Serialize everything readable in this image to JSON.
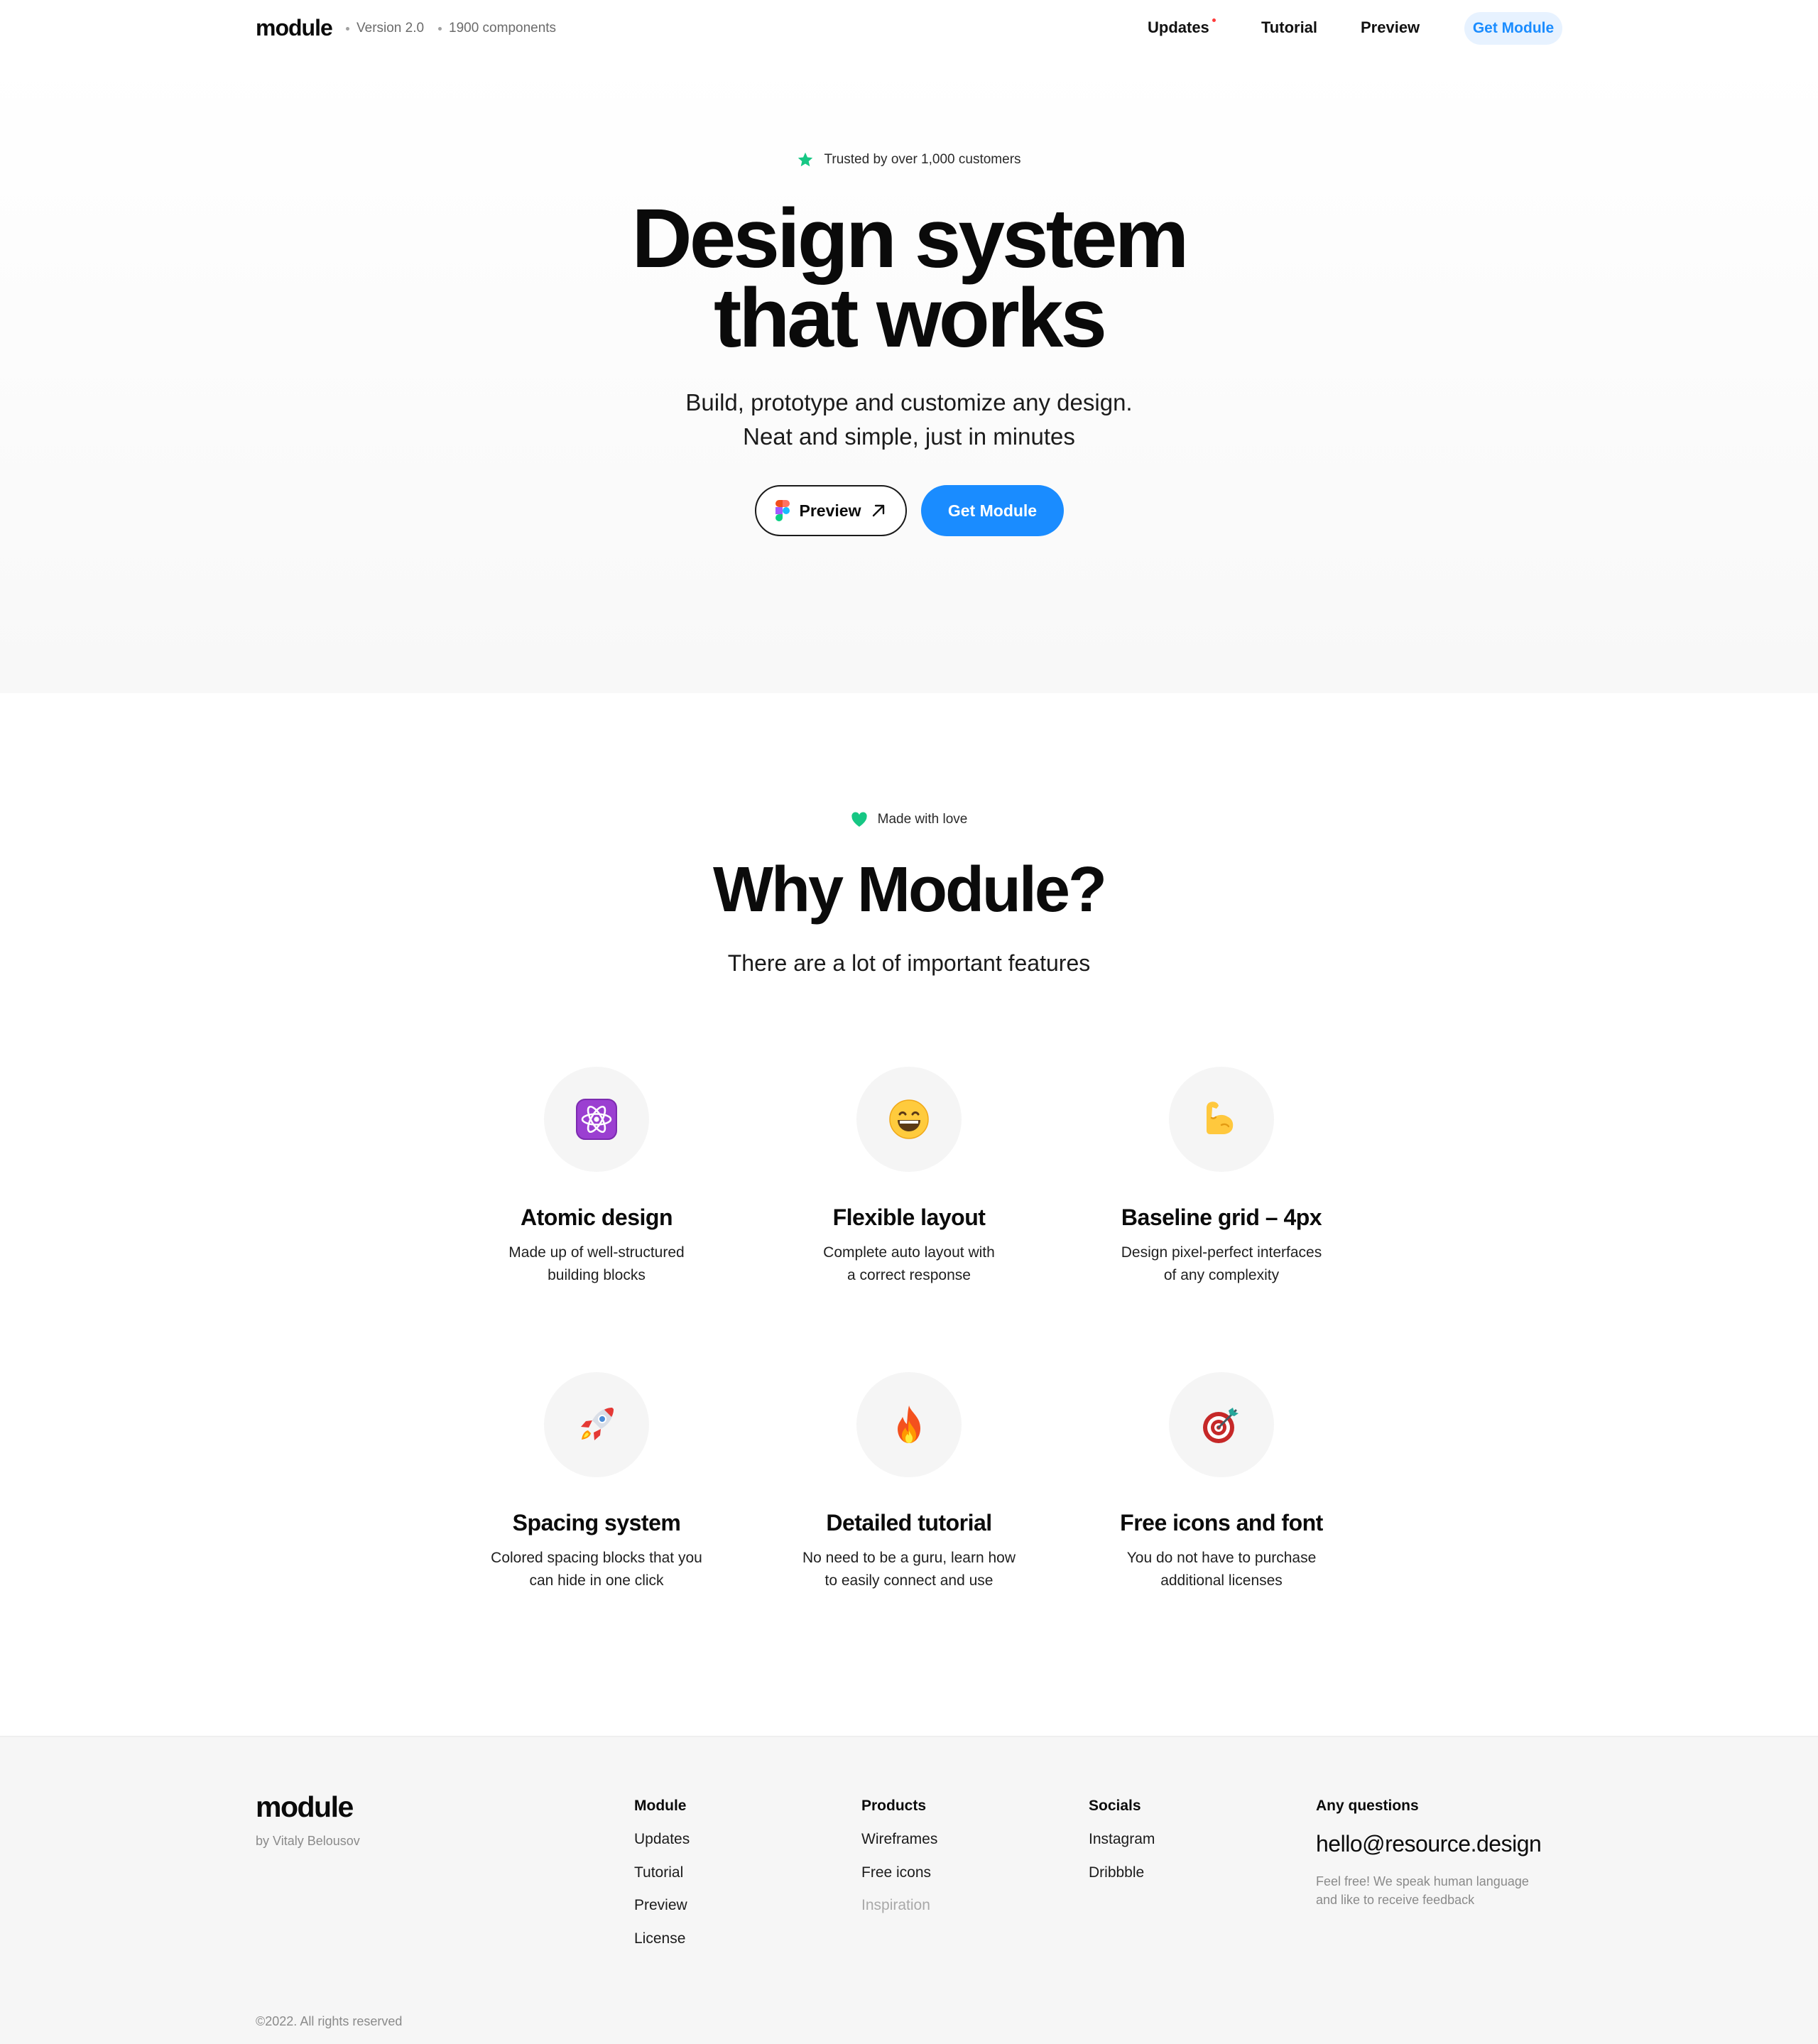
{
  "header": {
    "logo": "module",
    "version": "Version 2.0",
    "components": "1900 components",
    "nav": {
      "updates": "Updates",
      "tutorial": "Tutorial",
      "preview": "Preview",
      "cta": "Get Module"
    },
    "updates_badge_color": "#ff3b3b",
    "cta_color": "#1a8cff"
  },
  "hero": {
    "badge_text": "Trusted by over 1,000 customers",
    "badge_icon": "star-icon",
    "title_line1": "Design system",
    "title_line2": "that works",
    "subtitle_line1": "Build, prototype and customize any design.",
    "subtitle_line2": "Neat and simple, just in minutes",
    "preview_button": "Preview",
    "get_button": "Get Module"
  },
  "features": {
    "badge_text": "Made with love",
    "badge_icon": "heart-icon",
    "title": "Why Module?",
    "subtitle": "There are a lot of important features",
    "items": [
      {
        "icon": "atom-icon",
        "emoji": "⚛️",
        "title": "Atomic design",
        "desc": "Made up of well-structured\nbuilding blocks"
      },
      {
        "icon": "smile-icon",
        "emoji": "😄",
        "title": "Flexible layout",
        "desc": "Complete auto layout with\na correct response"
      },
      {
        "icon": "muscle-icon",
        "emoji": "💪",
        "title": "Baseline grid – 4px",
        "desc": "Design pixel-perfect interfaces\nof any complexity"
      },
      {
        "icon": "rocket-icon",
        "emoji": "🚀",
        "title": "Spacing system",
        "desc": "Colored spacing blocks that you\ncan hide in one click"
      },
      {
        "icon": "fire-icon",
        "emoji": "🔥",
        "title": "Detailed tutorial",
        "desc": "No need to be a guru, learn how\nto easily connect and use"
      },
      {
        "icon": "target-icon",
        "emoji": "🎯",
        "title": "Free icons and font",
        "desc": "You do not have to purchase\nadditional licenses"
      }
    ]
  },
  "footer": {
    "logo": "module",
    "by": "by Vitaly Belousov",
    "columns": {
      "module": {
        "heading": "Module",
        "links": [
          "Updates",
          "Tutorial",
          "Preview",
          "License"
        ]
      },
      "products": {
        "heading": "Products",
        "links": [
          "Wireframes",
          "Free icons",
          "Inspiration"
        ]
      },
      "socials": {
        "heading": "Socials",
        "links": [
          "Instagram",
          "Dribbble"
        ]
      },
      "questions": {
        "heading": "Any questions",
        "email": "hello@resource.design",
        "note": "Feel free! We speak human language\nand like to receive feedback"
      }
    },
    "copyright": "©2022. All rights reserved"
  },
  "colors": {
    "accent": "#1a8cff",
    "accent_soft": "#e7f2ff",
    "badge_green": "#16c784"
  }
}
